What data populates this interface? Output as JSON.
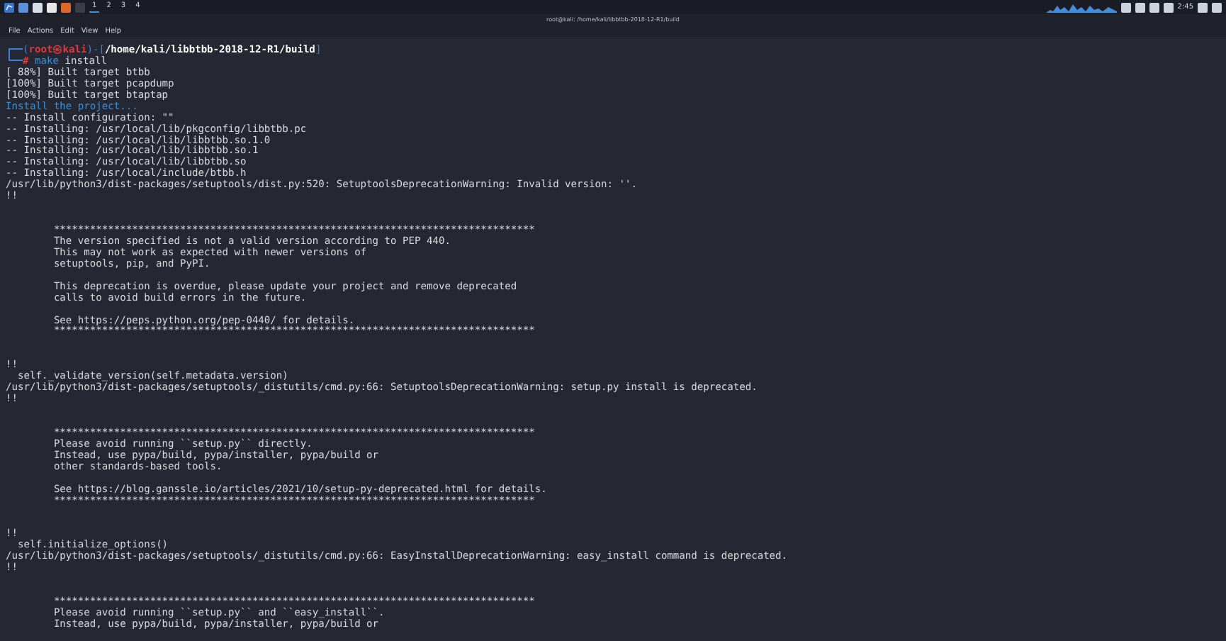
{
  "panel": {
    "workspaces": [
      {
        "label": "1",
        "selected": true
      },
      {
        "label": "2",
        "selected": false
      },
      {
        "label": "3",
        "selected": false
      },
      {
        "label": "4",
        "selected": false
      }
    ],
    "clock": "2:45"
  },
  "window": {
    "title": "root@kali: /home/kali/libbtbb-2018-12-R1/build"
  },
  "menu": [
    "File",
    "Actions",
    "Edit",
    "View",
    "Help"
  ],
  "prompt": {
    "open": "(",
    "user_host": "root㉿kali",
    "mid": ")-[",
    "path": "/home/kali/libbtbb-2018-12-R1/build",
    "close": "]",
    "symbol": "#",
    "command": "make",
    "args": "install"
  },
  "lines": [
    {
      "kind": "output",
      "text": "[ 88%] Built target btbb"
    },
    {
      "kind": "output",
      "text": "[100%] Built target pcapdump"
    },
    {
      "kind": "output",
      "text": "[100%] Built target btaptap"
    },
    {
      "kind": "info",
      "text": "Install the project..."
    },
    {
      "kind": "output",
      "text": "-- Install configuration: \"\""
    },
    {
      "kind": "output",
      "text": "-- Installing: /usr/local/lib/pkgconfig/libbtbb.pc"
    },
    {
      "kind": "output",
      "text": "-- Installing: /usr/local/lib/libbtbb.so.1.0"
    },
    {
      "kind": "output",
      "text": "-- Installing: /usr/local/lib/libbtbb.so.1"
    },
    {
      "kind": "output",
      "text": "-- Installing: /usr/local/lib/libbtbb.so"
    },
    {
      "kind": "output",
      "text": "-- Installing: /usr/local/include/btbb.h"
    },
    {
      "kind": "output",
      "text": "/usr/lib/python3/dist-packages/setuptools/dist.py:520: SetuptoolsDeprecationWarning: Invalid version: ''."
    },
    {
      "kind": "output",
      "text": "!!"
    },
    {
      "kind": "blank"
    },
    {
      "kind": "blank"
    },
    {
      "kind": "boxed",
      "text": "********************************************************************************"
    },
    {
      "kind": "boxed",
      "text": "The version specified is not a valid version according to PEP 440."
    },
    {
      "kind": "boxed",
      "text": "This may not work as expected with newer versions of"
    },
    {
      "kind": "boxed",
      "text": "setuptools, pip, and PyPI."
    },
    {
      "kind": "blank"
    },
    {
      "kind": "boxed",
      "text": "This deprecation is overdue, please update your project and remove deprecated"
    },
    {
      "kind": "boxed",
      "text": "calls to avoid build errors in the future."
    },
    {
      "kind": "blank"
    },
    {
      "kind": "boxed",
      "text": "See https://peps.python.org/pep-0440/ for details."
    },
    {
      "kind": "boxed",
      "text": "********************************************************************************"
    },
    {
      "kind": "blank"
    },
    {
      "kind": "blank"
    },
    {
      "kind": "output",
      "text": "!!"
    },
    {
      "kind": "code",
      "text": "self._validate_version(self.metadata.version)"
    },
    {
      "kind": "output",
      "text": "/usr/lib/python3/dist-packages/setuptools/_distutils/cmd.py:66: SetuptoolsDeprecationWarning: setup.py install is deprecated."
    },
    {
      "kind": "output",
      "text": "!!"
    },
    {
      "kind": "blank"
    },
    {
      "kind": "blank"
    },
    {
      "kind": "boxed",
      "text": "********************************************************************************"
    },
    {
      "kind": "boxed",
      "text": "Please avoid running ``setup.py`` directly."
    },
    {
      "kind": "boxed",
      "text": "Instead, use pypa/build, pypa/installer, pypa/build or"
    },
    {
      "kind": "boxed",
      "text": "other standards-based tools."
    },
    {
      "kind": "blank"
    },
    {
      "kind": "boxed",
      "text": "See https://blog.ganssle.io/articles/2021/10/setup-py-deprecated.html for details."
    },
    {
      "kind": "boxed",
      "text": "********************************************************************************"
    },
    {
      "kind": "blank"
    },
    {
      "kind": "blank"
    },
    {
      "kind": "output",
      "text": "!!"
    },
    {
      "kind": "code",
      "text": "self.initialize_options()"
    },
    {
      "kind": "output",
      "text": "/usr/lib/python3/dist-packages/setuptools/_distutils/cmd.py:66: EasyInstallDeprecationWarning: easy_install command is deprecated."
    },
    {
      "kind": "output",
      "text": "!!"
    },
    {
      "kind": "blank"
    },
    {
      "kind": "blank"
    },
    {
      "kind": "boxed",
      "text": "********************************************************************************"
    },
    {
      "kind": "boxed",
      "text": "Please avoid running ``setup.py`` and ``easy_install``."
    },
    {
      "kind": "boxed",
      "text": "Instead, use pypa/build, pypa/installer, pypa/build or"
    }
  ]
}
